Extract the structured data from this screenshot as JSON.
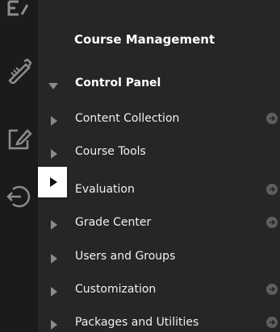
{
  "panel": {
    "title": "Course Management",
    "items": [
      {
        "label": "Control Panel",
        "expanded": true,
        "bold": true,
        "has_arrow": false
      },
      {
        "label": "Content Collection",
        "expanded": false,
        "bold": false,
        "has_arrow": true
      },
      {
        "label": "Course Tools",
        "expanded": false,
        "bold": false,
        "has_arrow": false
      },
      {
        "label": "Evaluation",
        "expanded": false,
        "bold": false,
        "has_arrow": true
      },
      {
        "label": "Grade Center",
        "expanded": false,
        "bold": false,
        "has_arrow": true
      },
      {
        "label": "Users and Groups",
        "expanded": false,
        "bold": false,
        "has_arrow": false
      },
      {
        "label": "Customization",
        "expanded": false,
        "bold": false,
        "has_arrow": true
      },
      {
        "label": "Packages and Utilities",
        "expanded": false,
        "bold": false,
        "has_arrow": true
      }
    ]
  },
  "rail": {
    "icons": [
      "edit-icon",
      "pencil-ruler-icon",
      "edit-box-icon",
      "exit-icon"
    ]
  },
  "toggle": {
    "icon": "play-right-icon"
  },
  "colors": {
    "rail_bg": "#1b1b1b",
    "panel_bg": "#262626",
    "text": "#f0f0f0",
    "caret": "#8a8a8a",
    "arrow_circle": "#5e5e5e"
  }
}
